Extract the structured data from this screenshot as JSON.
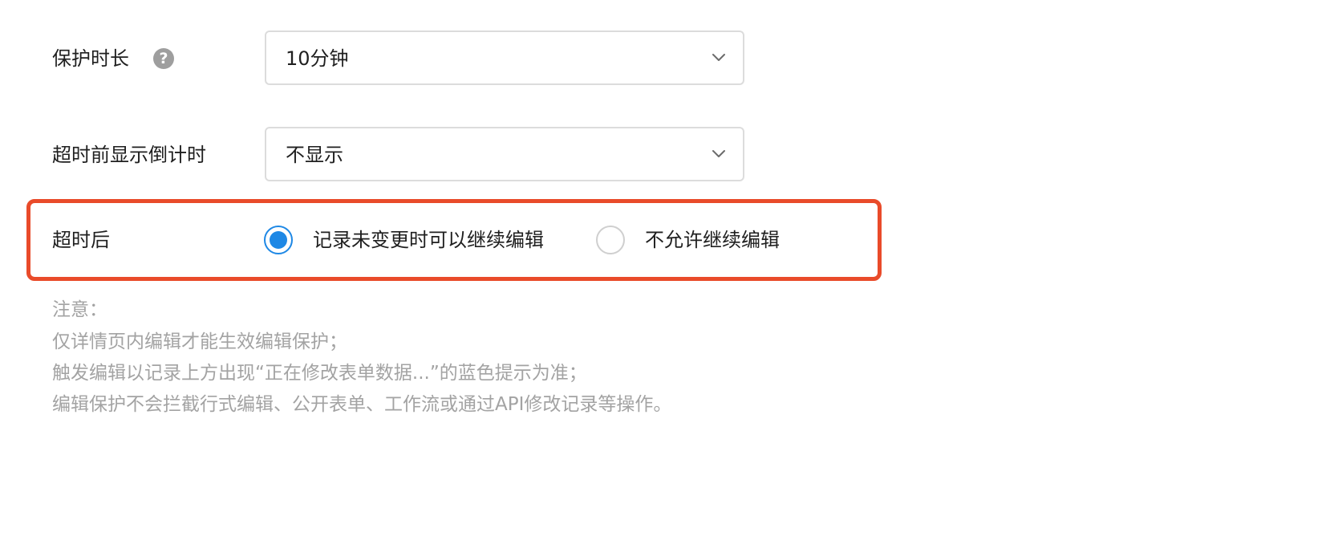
{
  "protection_duration": {
    "label": "保护时长",
    "help_icon": "?",
    "selected": "10分钟"
  },
  "countdown": {
    "label": "超时前显示倒计时",
    "selected": "不显示"
  },
  "after_timeout": {
    "label": "超时后",
    "options": [
      {
        "label": "记录未变更时可以继续编辑",
        "checked": true
      },
      {
        "label": "不允许继续编辑",
        "checked": false
      }
    ]
  },
  "notes": {
    "title": "注意：",
    "lines": [
      "仅详情页内编辑才能生效编辑保护；",
      "触发编辑以记录上方出现“正在修改表单数据...”的蓝色提示为准；",
      "编辑保护不会拦截行式编辑、公开表单、工作流或通过API修改记录等操作。"
    ]
  },
  "colors": {
    "accent": "#1e88e5",
    "highlight": "#e94b2a",
    "note_text": "#a3a3a3"
  },
  "icons": {
    "help": "help-circle-icon",
    "dropdown": "chevron-down-icon"
  }
}
